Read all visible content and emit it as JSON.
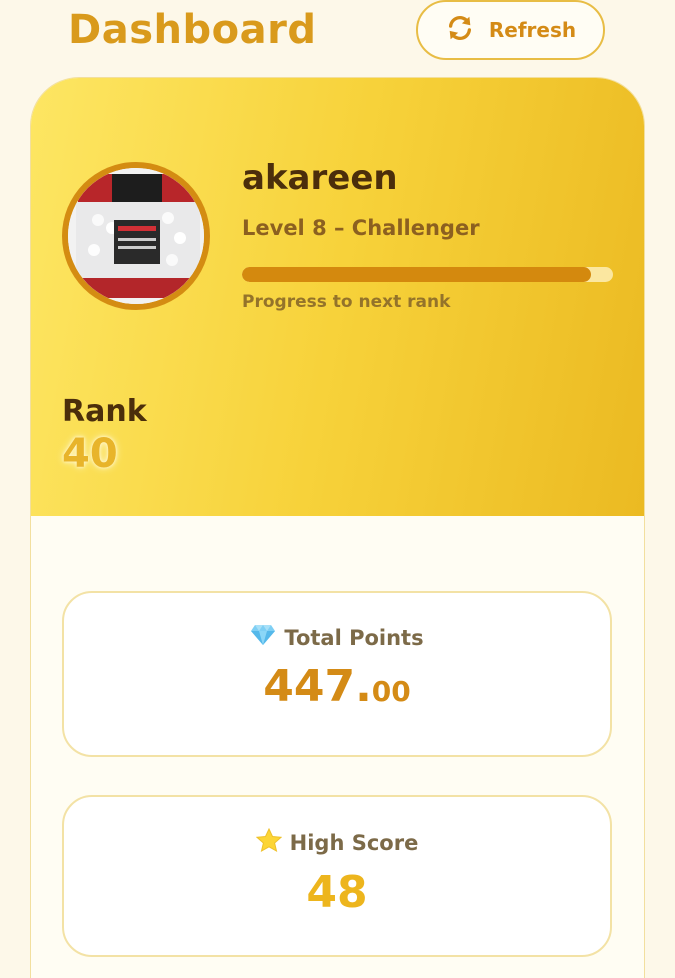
{
  "header": {
    "title": "Dashboard",
    "refresh_label": "Refresh",
    "refresh_icon": "refresh-icon"
  },
  "profile": {
    "username": "akareen",
    "level": "Level 8 – Challenger",
    "progress_fraction": 0.94,
    "progress_caption": "Progress to next rank",
    "rank_label": "Rank",
    "rank_value": "40",
    "avatar_icon": "product-photo"
  },
  "stats": {
    "total_points": {
      "icon": "gem-icon",
      "label": "Total Points",
      "value_int": "447.",
      "value_dec": "00"
    },
    "high_score": {
      "icon": "star-icon",
      "label": "High Score",
      "value": "48"
    }
  },
  "colors": {
    "accent": "#d99a1c",
    "header_gradient_start": "#fde663",
    "header_gradient_end": "#ebba22",
    "progress_fill": "#d4890e",
    "background": "#fdf8e9"
  }
}
